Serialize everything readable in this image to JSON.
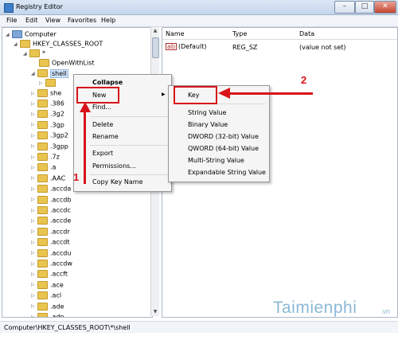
{
  "window": {
    "title": "Registry Editor"
  },
  "menubar": {
    "items": [
      "File",
      "Edit",
      "View",
      "Favorites",
      "Help"
    ]
  },
  "tree": {
    "computer": "Computer",
    "root": "HKEY_CLASSES_ROOT",
    "star": "*",
    "open_with_list": "OpenWithList",
    "shell": "shell",
    "shell_child": "",
    "shellex_partial": "she",
    "extensions": [
      ".386",
      ".3g2",
      ".3gp",
      ".3gp2",
      ".3gpp",
      ".7z",
      ".a",
      ".AAC",
      ".accda",
      ".accdb",
      ".accdc",
      ".accde",
      ".accdr",
      ".accdt",
      ".accdu",
      ".accdw",
      ".accft",
      ".ace",
      ".acl",
      ".ade",
      ".adn"
    ]
  },
  "values": {
    "columns": {
      "name": "Name",
      "type": "Type",
      "data": "Data"
    },
    "rows": [
      {
        "name": "(Default)",
        "type": "REG_SZ",
        "data": "(value not set)",
        "icon": "ab"
      }
    ]
  },
  "context_menu": {
    "collapse": "Collapse",
    "new": "New",
    "find": "Find...",
    "delete": "Delete",
    "rename": "Rename",
    "export": "Export",
    "permissions": "Permissions...",
    "copy_key_name": "Copy Key Name"
  },
  "submenu": {
    "key": "Key",
    "string_value": "String Value",
    "binary_value": "Binary Value",
    "dword": "DWORD (32-bit) Value",
    "qword": "QWORD (64-bit) Value",
    "multi_string": "Multi-String Value",
    "expandable_string": "Expandable String Value"
  },
  "annotations": {
    "step1": "1",
    "step2": "2",
    "color": "#d8141a"
  },
  "status_bar": {
    "path": "Computer\\HKEY_CLASSES_ROOT\\*\\shell"
  },
  "watermark": {
    "brand": "Taimienphi",
    "suffix": ".vn"
  },
  "colors": {
    "folder": "#e9c54f",
    "selection": "#cfe3fa",
    "title_bar": "#dbe7f5"
  }
}
